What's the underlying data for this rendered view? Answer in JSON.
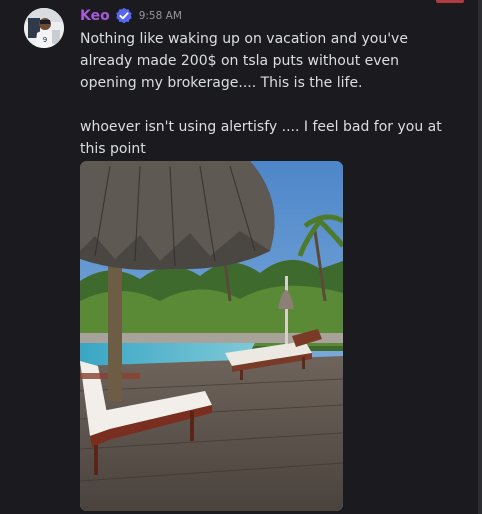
{
  "message": {
    "author": "Keo",
    "timestamp": "9:58 AM",
    "paragraphs": [
      "Nothing like waking up on vacation and you've already made 200$ on tsla puts without even opening my brokerage.... This is the life.",
      "whoever isn't using alertisfy .... I feel bad for you at this point"
    ],
    "colors": {
      "author": "#a85bd6",
      "verified_badge": "#5865f2",
      "background": "#1b1b1f",
      "text": "#dbdee1",
      "timestamp": "#94959c"
    },
    "icons": {
      "verified": "verified-check-icon"
    }
  }
}
